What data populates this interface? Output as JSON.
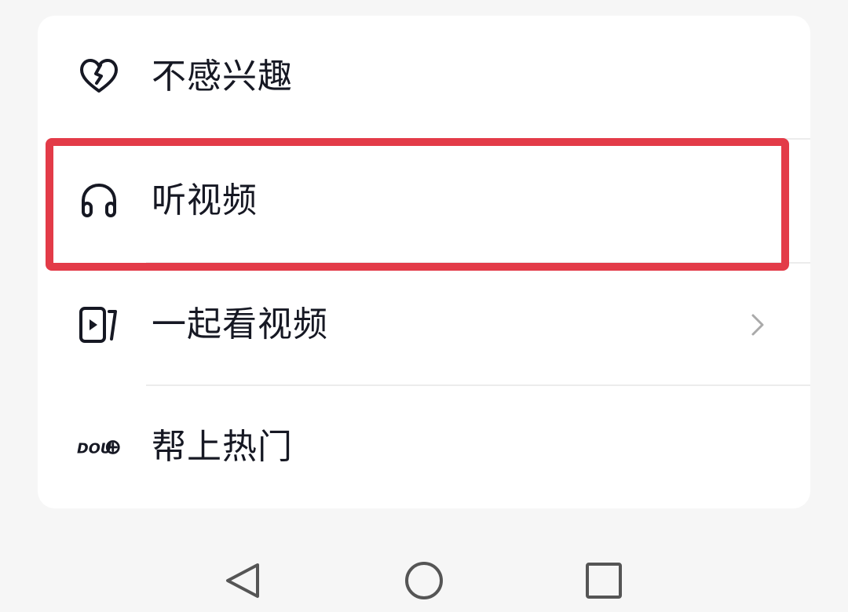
{
  "menu": {
    "items": [
      {
        "label": "不感兴趣",
        "icon": "broken-heart-icon"
      },
      {
        "label": "听视频",
        "icon": "headphones-icon"
      },
      {
        "label": "一起看视频",
        "icon": "watch-together-icon"
      },
      {
        "label": "帮上热门",
        "icon": "dou-plus-icon",
        "icon_text": "DOU+"
      }
    ]
  },
  "colors": {
    "highlight": "#e33b48",
    "text": "#161823",
    "background": "#f6f6f6",
    "card": "#ffffff"
  },
  "navigation": {
    "buttons": [
      "back-triangle-icon",
      "home-circle-icon",
      "recents-square-icon"
    ]
  }
}
